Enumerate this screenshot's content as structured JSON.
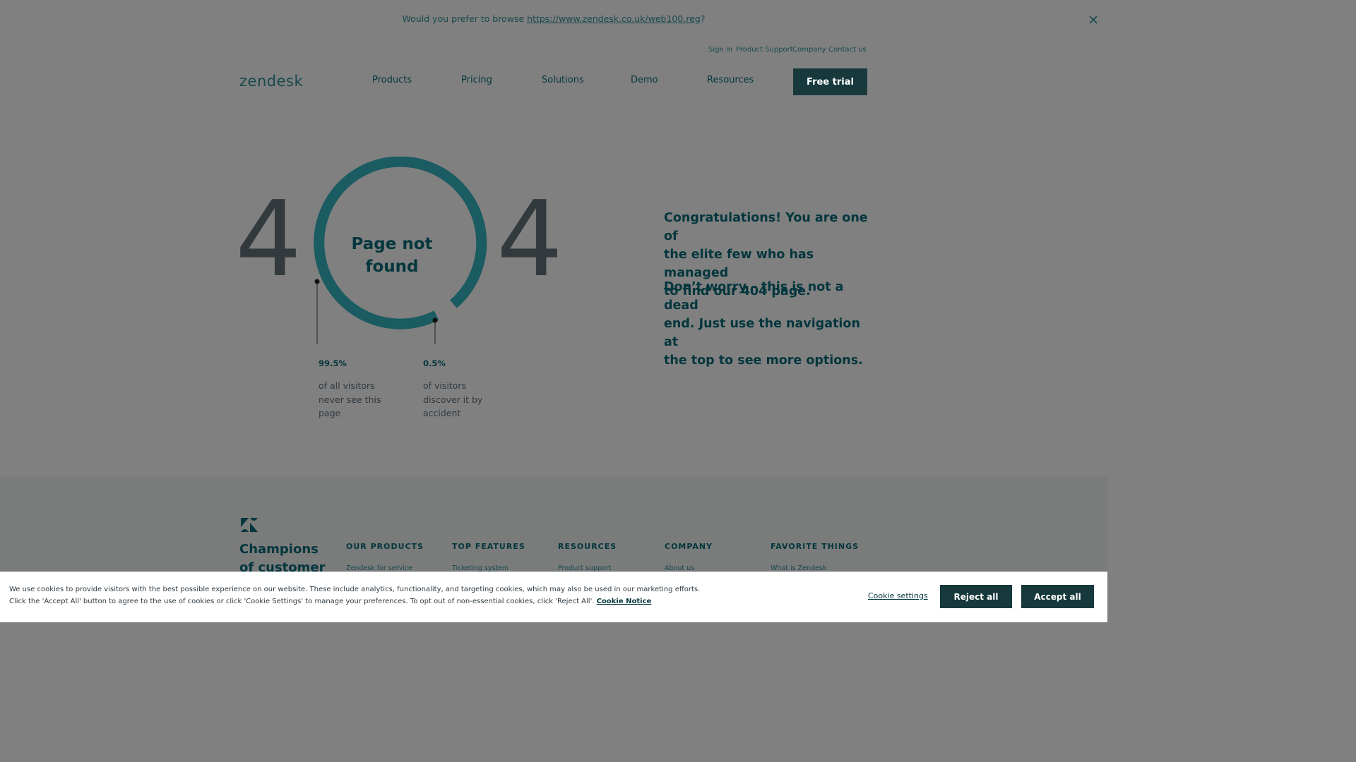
{
  "region_banner": {
    "prefix": "Would you prefer to browse ",
    "link_text": "https://www.zendesk.co.uk/web100.reg",
    "suffix": "?"
  },
  "utility_nav": [
    "Sign in",
    "Product Support",
    "Company",
    "Contact us"
  ],
  "logo_text": "zendesk",
  "main_nav": [
    "Products",
    "Pricing",
    "Solutions",
    "Demo",
    "Resources"
  ],
  "cta_label": "Free trial",
  "hero": {
    "digit_left": "4",
    "digit_right": "4",
    "ring_title_line1": "Page not",
    "ring_title_line2": "found",
    "stats": [
      {
        "percent": "99.5%",
        "desc_lines": [
          "of all visitors",
          "never see this",
          "page"
        ]
      },
      {
        "percent": "0.5%",
        "desc_lines": [
          "of visitors",
          "discover it by",
          "accident"
        ]
      }
    ],
    "paragraph1_lines": [
      "Congratulations! You are one of",
      "the elite few who has managed",
      "to find our 404 page."
    ],
    "paragraph2_lines": [
      "Don’t worry – this is not a dead",
      "end. Just use the navigation at",
      "the top to see more options."
    ]
  },
  "footer": {
    "tagline_lines": [
      "Champions",
      "of customer"
    ],
    "columns": [
      {
        "heading": "OUR PRODUCTS",
        "first_link": "Zendesk for service"
      },
      {
        "heading": "TOP FEATURES",
        "first_link": "Ticketing system"
      },
      {
        "heading": "RESOURCES",
        "first_link": "Product support"
      },
      {
        "heading": "COMPANY",
        "first_link": "About us"
      },
      {
        "heading": "FAVORITE THINGS",
        "first_link": "What is Zendesk"
      }
    ]
  },
  "cookie_banner": {
    "line1": "We use cookies to provide visitors with the best possible experience on our website. These include analytics, functionality, and targeting cookies, which may also be used in our marketing efforts.",
    "line2": "Click the 'Accept All' button to agree to the use of cookies or click 'Cookie Settings' to manage your preferences. To opt out of non-essential cookies, click 'Reject All'.",
    "notice_link": "Cookie Notice",
    "settings_label": "Cookie settings",
    "reject_label": "Reject all",
    "accept_label": "Accept all"
  },
  "colors": {
    "overlay_bg": "#808080",
    "brand_dark": "#17393c",
    "ring": "#1b5b62",
    "text_dark": "#03363d"
  },
  "icons": {
    "close": "close-icon",
    "footer_logo": "zendesk-logo-icon"
  }
}
